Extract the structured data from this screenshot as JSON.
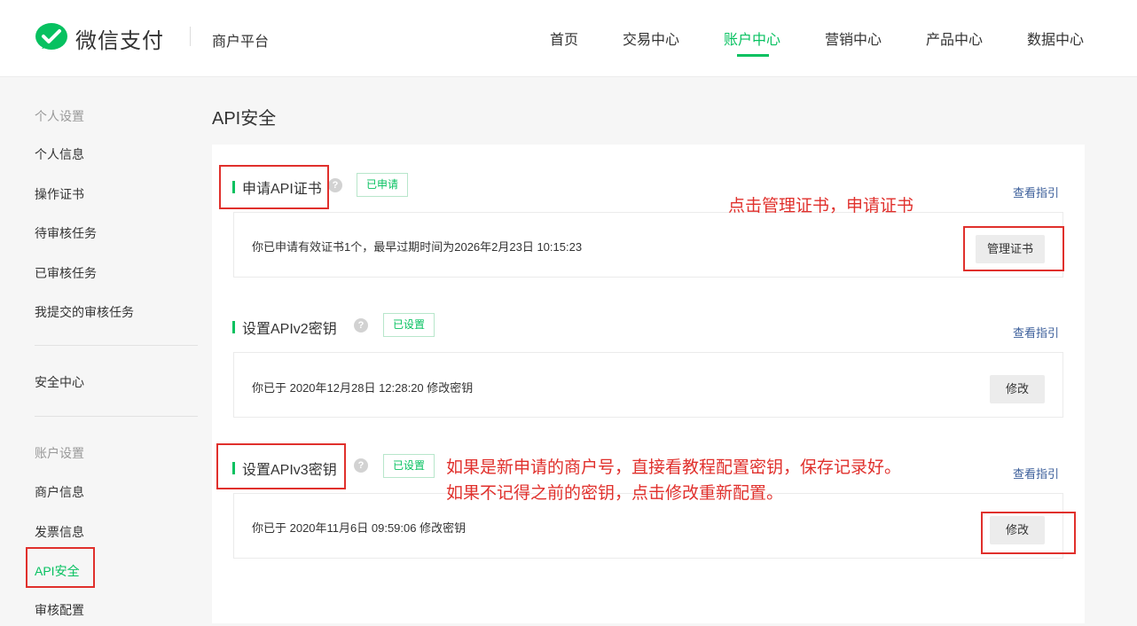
{
  "header": {
    "brand": "微信支付",
    "platform": "商户平台",
    "nav": [
      "首页",
      "交易中心",
      "账户中心",
      "营销中心",
      "产品中心",
      "数据中心"
    ],
    "active_nav": "账户中心",
    "accent_color": "#07c160"
  },
  "sidebar": {
    "group_personal": "个人设置",
    "personal_items": [
      "个人信息",
      "操作证书",
      "待审核任务",
      "已审核任务",
      "我提交的审核任务"
    ],
    "security_center": "安全中心",
    "group_account": "账户设置",
    "account_items": [
      "商户信息",
      "发票信息",
      "API安全",
      "审核配置"
    ],
    "active_item": "API安全"
  },
  "main": {
    "title": "API安全",
    "sections": [
      {
        "title": "申请API证书",
        "tag": "已申请",
        "guide": "查看指引",
        "text": "你已申请有效证书1个，最早过期时间为2026年2月23日 10:15:23",
        "button": "管理证书"
      },
      {
        "title": "设置APIv2密钥",
        "tag": "已设置",
        "guide": "查看指引",
        "text": "你已于 2020年12月28日 12:28:20 修改密钥",
        "button": "修改"
      },
      {
        "title": "设置APIv3密钥",
        "tag": "已设置",
        "guide": "查看指引",
        "text": "你已于 2020年11月6日 09:59:06 修改密钥",
        "button": "修改"
      }
    ]
  },
  "annotations": {
    "note_cert": "点击管理证书，申请证书",
    "note_v3_line1": "如果是新申请的商户号，直接看教程配置密钥，保存记录好。",
    "note_v3_line2": "如果不记得之前的密钥，点击修改重新配置。",
    "color": "#e0302c"
  },
  "icons": {
    "logo": "wechat-pay-logo-icon",
    "help": "question-mark-icon"
  }
}
